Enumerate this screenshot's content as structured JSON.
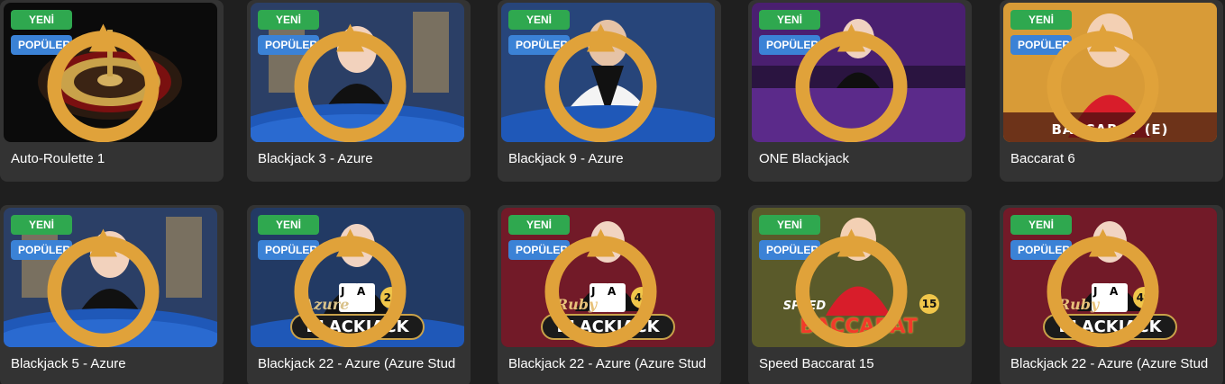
{
  "colors": {
    "page_bg": "#1f1f1f",
    "card_bg": "#333333",
    "new_badge": "#2fa84f",
    "popular_badge": "#3b82d6",
    "title_text": "#ffffff"
  },
  "badges": {
    "new": "YENİ",
    "popular": "POPÜLER"
  },
  "games": [
    {
      "title": "Auto-Roulette 1",
      "theme": "roulette",
      "overlay": ""
    },
    {
      "title": "Blackjack 3 - Azure",
      "theme": "azure-table",
      "overlay": ""
    },
    {
      "title": "Blackjack 9 - Azure",
      "theme": "azure-dealer",
      "overlay": ""
    },
    {
      "title": "ONE Blackjack",
      "theme": "purple-table",
      "overlay": ""
    },
    {
      "title": "Baccarat 6",
      "theme": "gold",
      "overlay": "BACCARAT (E)"
    },
    {
      "title": "Blackjack 5 - Azure",
      "theme": "azure-table",
      "overlay": ""
    },
    {
      "title": "Blackjack 22 - Azure (Azure Stud",
      "theme": "azure-logo",
      "overlay": "BLACKJACK",
      "overlay_script": "Azure",
      "table_no": "24"
    },
    {
      "title": "Blackjack 22 - Azure (Azure Stud",
      "theme": "ruby-logo",
      "overlay": "BLACKJACK",
      "overlay_script": "Ruby",
      "table_no": "40"
    },
    {
      "title": "Speed Baccarat 15",
      "theme": "speed-baccarat",
      "overlay": "BACCARAT",
      "overlay_script": "SPEED",
      "table_no": "15"
    },
    {
      "title": "Blackjack 22 - Azure (Azure Stud",
      "theme": "ruby-logo",
      "overlay": "BLACKJACK",
      "overlay_script": "Ruby",
      "table_no": "49"
    }
  ]
}
